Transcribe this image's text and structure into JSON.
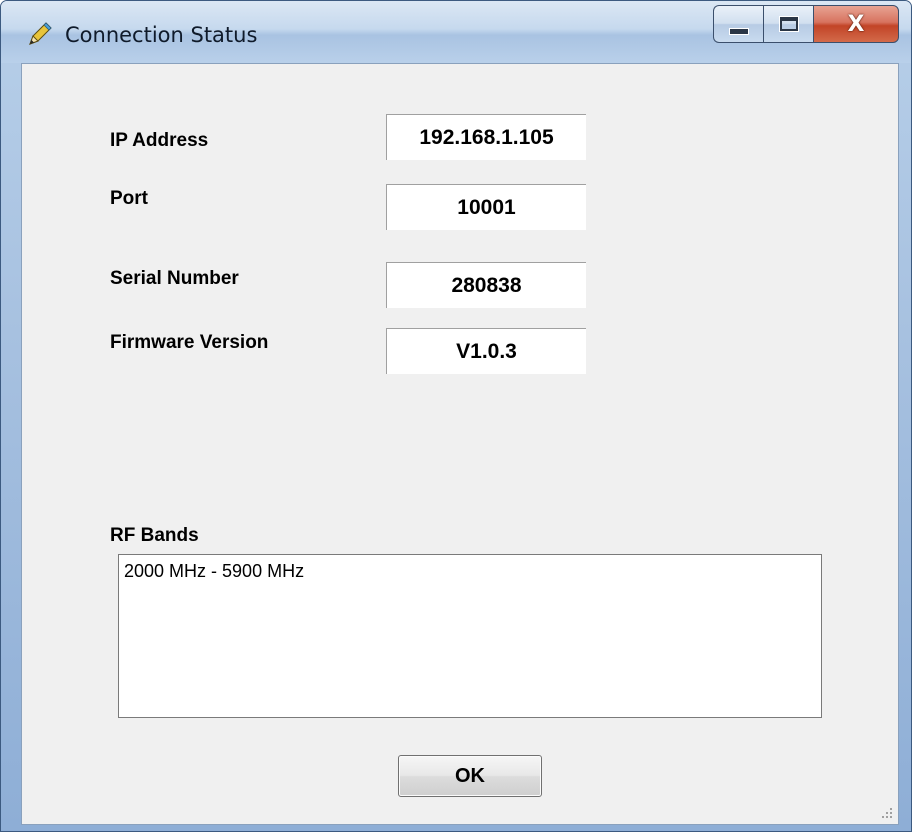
{
  "window": {
    "title": "Connection Status",
    "title_icon": "pencil-icon",
    "close_glyph": "X"
  },
  "fields": [
    {
      "label": "IP Address",
      "value": "192.168.1.105"
    },
    {
      "label": "Port",
      "value": "10001"
    },
    {
      "label": "Serial Number",
      "value": "280838"
    },
    {
      "label": "Firmware Version",
      "value": "V1.0.3"
    }
  ],
  "rf_bands": {
    "label": "RF Bands",
    "items": [
      "2000 MHz - 5900 MHz"
    ]
  },
  "buttons": {
    "ok_label": "OK"
  },
  "colors": {
    "client_background": "#f0f0f0",
    "close_button": "#c24427",
    "title_bar": "#b9d0ea"
  }
}
